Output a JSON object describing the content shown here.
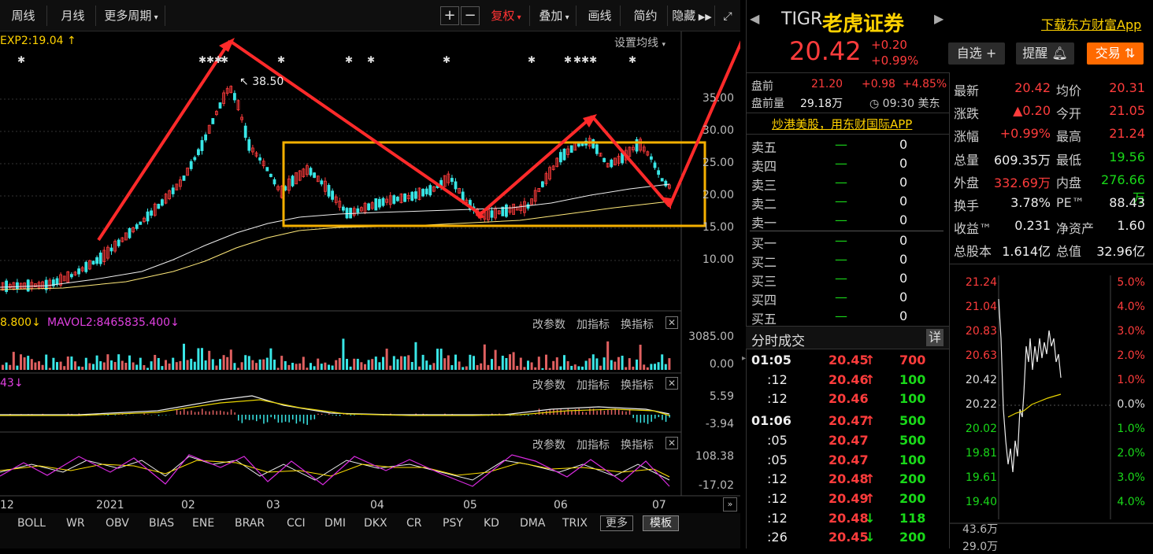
{
  "toolbar": {
    "weekly": "周线",
    "monthly": "月线",
    "more_periods": "更多周期",
    "plus": "+",
    "minus": "−",
    "restore": "复权",
    "overlay": "叠加",
    "draw": "画线",
    "simple": "简约",
    "hide": "隐藏"
  },
  "chart": {
    "exp_label": "EXP2:19.04",
    "ma_settings": "设置均线",
    "peak_label": "38.50",
    "y_main": [
      "35.00",
      "30.00",
      "25.00",
      "20.00",
      "15.00",
      "10.00"
    ],
    "vol_label_a": "8.800",
    "vol_label_b": "MAVOL2:8465835.400",
    "vol_y": [
      "3085.00",
      "0.00"
    ],
    "macd_label": "43",
    "macd_y": [
      "5.59",
      "-3.94"
    ],
    "kdj_y": [
      "108.38",
      "-17.02"
    ],
    "panel_buttons": [
      "改参数",
      "加指标",
      "换指标"
    ],
    "x_labels": [
      "12",
      "2021",
      "02",
      "03",
      "04",
      "05",
      "06",
      "07"
    ]
  },
  "indicators": [
    "BOLL",
    "WR",
    "OBV",
    "BIAS",
    "ENE",
    "BRAR",
    "CCI",
    "DMI",
    "DKX",
    "CR",
    "PSY",
    "KD",
    "DMA",
    "TRIX"
  ],
  "more_label": "更多",
  "template_label": "模板",
  "quote": {
    "ticker": "TIGR",
    "name": "老虎证券",
    "price": "20.42",
    "change": "+0.20",
    "change_pct": "+0.99%",
    "download_link": "下载东方财富App",
    "watch_btn": "自选",
    "alert_btn": "提醒",
    "trade_btn": "交易"
  },
  "premarket": {
    "label": "盘前",
    "price": "21.20",
    "change": "+0.98",
    "pct": "+4.85%",
    "vol_label": "盘前量",
    "vol": "29.18万",
    "time": "09:30 美东"
  },
  "promo": "炒港美股，用东财国际APP",
  "orderbook": {
    "sells": [
      {
        "label": "卖五",
        "price": "—",
        "vol": "0"
      },
      {
        "label": "卖四",
        "price": "—",
        "vol": "0"
      },
      {
        "label": "卖三",
        "price": "—",
        "vol": "0"
      },
      {
        "label": "卖二",
        "price": "—",
        "vol": "0"
      },
      {
        "label": "卖一",
        "price": "—",
        "vol": "0"
      }
    ],
    "buys": [
      {
        "label": "买一",
        "price": "—",
        "vol": "0"
      },
      {
        "label": "买二",
        "price": "—",
        "vol": "0"
      },
      {
        "label": "买三",
        "price": "—",
        "vol": "0"
      },
      {
        "label": "买四",
        "price": "—",
        "vol": "0"
      },
      {
        "label": "买五",
        "price": "—",
        "vol": "0"
      }
    ]
  },
  "ticks": {
    "title": "分时成交",
    "detail": "详",
    "rows": [
      {
        "time": "01:05",
        "price": "20.45",
        "vol": "700",
        "arrow": "up"
      },
      {
        "time": ":12",
        "price": "20.46",
        "vol": "100",
        "arrow": "up"
      },
      {
        "time": ":12",
        "price": "20.46",
        "vol": "100",
        "arrow": ""
      },
      {
        "time": "01:06",
        "price": "20.47",
        "vol": "500",
        "arrow": "up"
      },
      {
        "time": ":05",
        "price": "20.47",
        "vol": "500",
        "arrow": ""
      },
      {
        "time": ":05",
        "price": "20.47",
        "vol": "100",
        "arrow": ""
      },
      {
        "time": ":12",
        "price": "20.48",
        "vol": "200",
        "arrow": "up"
      },
      {
        "time": ":12",
        "price": "20.49",
        "vol": "200",
        "arrow": "up"
      },
      {
        "time": ":12",
        "price": "20.48",
        "vol": "118",
        "arrow": "down"
      },
      {
        "time": ":26",
        "price": "20.45",
        "vol": "200",
        "arrow": "down"
      }
    ]
  },
  "stats": [
    {
      "k1": "最新",
      "v1": "20.42",
      "c1": "red",
      "k2": "均价",
      "v2": "20.31",
      "c2": "red"
    },
    {
      "k1": "涨跌",
      "v1": "▲0.20",
      "c1": "red",
      "k2": "今开",
      "v2": "21.05",
      "c2": "red"
    },
    {
      "k1": "涨幅",
      "v1": "+0.99%",
      "c1": "red",
      "k2": "最高",
      "v2": "21.24",
      "c2": "red"
    },
    {
      "k1": "总量",
      "v1": "609.35万",
      "c1": "white",
      "k2": "最低",
      "v2": "19.56",
      "c2": "green"
    },
    {
      "k1": "外盘",
      "v1": "332.69万",
      "c1": "red",
      "k2": "内盘",
      "v2": "276.66万",
      "c2": "green"
    },
    {
      "k1": "换手",
      "v1": "3.78%",
      "c1": "white",
      "k2": "PE™",
      "v2": "88.43",
      "c2": "white"
    },
    {
      "k1": "收益™",
      "v1": "0.231",
      "c1": "white",
      "k2": "净资产",
      "v2": "1.60",
      "c2": "white"
    },
    {
      "k1": "总股本",
      "v1": "1.614亿",
      "c1": "white",
      "k2": "总值",
      "v2": "32.96亿",
      "c2": "white"
    }
  ],
  "intraday": {
    "left_y": [
      "21.24",
      "21.04",
      "20.83",
      "20.63",
      "20.42",
      "20.22",
      "20.02",
      "19.81",
      "19.61",
      "19.40"
    ],
    "right_y": [
      "5.0%",
      "4.0%",
      "3.0%",
      "2.0%",
      "1.0%",
      "0.0%",
      "1.0%",
      "2.0%",
      "3.0%",
      "4.0%"
    ],
    "vol_y": [
      "43.6万",
      "29.0万"
    ]
  },
  "colors": {
    "up": "#ff3c3c",
    "down": "#19d819",
    "accent": "#ff6a00",
    "box": "#f5b000"
  }
}
